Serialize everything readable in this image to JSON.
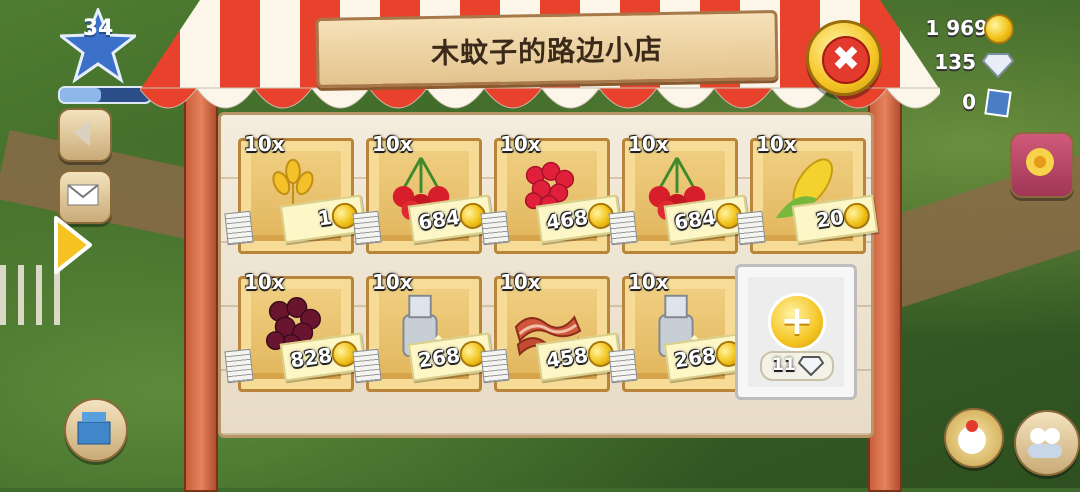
{
  "shop": {
    "title": "木蚊子的路边小店",
    "close_label": "✖"
  },
  "hud": {
    "level": "34",
    "coins": "1 969",
    "diamonds": "135",
    "vouchers": "0",
    "xp_progress": 0.45
  },
  "slots": [
    {
      "qty": "10x",
      "item": "wheat-icon",
      "price": "1"
    },
    {
      "qty": "10x",
      "item": "cherries-icon",
      "price": "684"
    },
    {
      "qty": "10x",
      "item": "raspberry-icon",
      "price": "468"
    },
    {
      "qty": "10x",
      "item": "cherries-icon",
      "price": "684"
    },
    {
      "qty": "10x",
      "item": "corn-icon",
      "price": "20"
    },
    {
      "qty": "10x",
      "item": "blackberry-icon",
      "price": "828"
    },
    {
      "qty": "10x",
      "item": "milk-can-icon",
      "price": "268"
    },
    {
      "qty": "10x",
      "item": "bacon-icon",
      "price": "458"
    },
    {
      "qty": "10x",
      "item": "milk-can-icon",
      "price": "268"
    }
  ],
  "add_slot": {
    "plus": "+",
    "cost": "11"
  },
  "colors": {
    "awning_red": "#e8412c",
    "awning_white": "#fbf5ea",
    "board": "#efe5d2",
    "crate": "#e7be68",
    "coin": "#f2c21a"
  }
}
